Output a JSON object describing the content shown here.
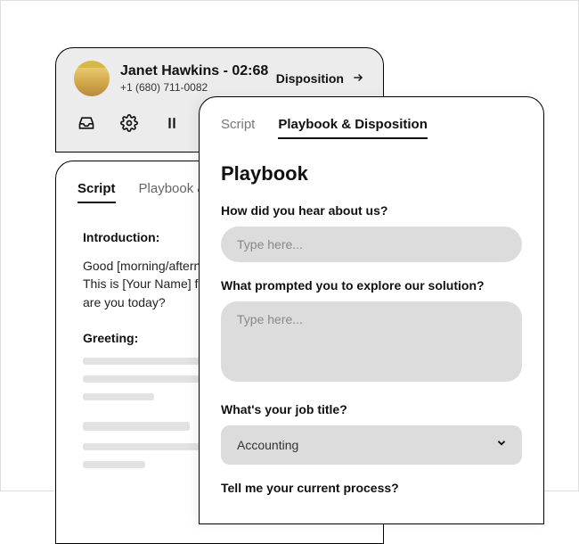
{
  "call": {
    "name": "Janet Hawkins - 02:68",
    "phone": "+1 (680) 711-0082",
    "disposition_label": "Disposition"
  },
  "script_card": {
    "tabs": [
      "Script",
      "Playbook & Disposition"
    ],
    "intro_head": "Introduction:",
    "intro_body": "Good [morning/afternoon], [Prospect's Name]! This is [Your Name] from [Your Company]. How are you today?",
    "greeting_head": "Greeting:"
  },
  "playbook": {
    "tabs": [
      "Script",
      "Playbook & Disposition"
    ],
    "title": "Playbook",
    "q1": "How did you hear about us?",
    "q1_placeholder": "Type here...",
    "q2": "What prompted you to explore our solution?",
    "q2_placeholder": "Type here...",
    "q3": "What's your job title?",
    "q3_value": "Accounting",
    "q4": "Tell me your current process?"
  }
}
